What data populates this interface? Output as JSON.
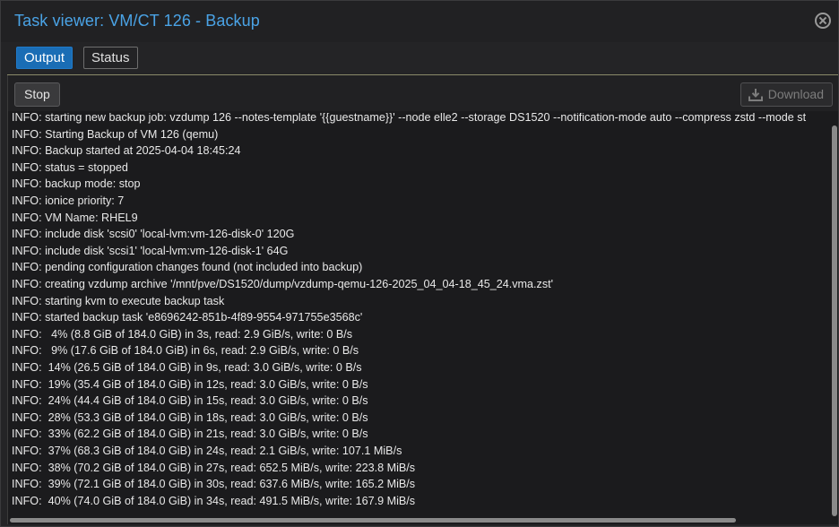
{
  "window": {
    "title": "Task viewer: VM/CT 126 - Backup"
  },
  "tabs": [
    {
      "label": "Output",
      "active": true
    },
    {
      "label": "Status",
      "active": false
    }
  ],
  "toolbar": {
    "stop_label": "Stop",
    "download_label": "Download"
  },
  "colors": {
    "accent": "#1a6db5",
    "title": "#4aa3e6"
  },
  "log": {
    "lines": [
      "INFO: starting new backup job: vzdump 126 --notes-template '{{guestname}}' --node elle2 --storage DS1520 --notification-mode auto --compress zstd --mode st",
      "INFO: Starting Backup of VM 126 (qemu)",
      "INFO: Backup started at 2025-04-04 18:45:24",
      "INFO: status = stopped",
      "INFO: backup mode: stop",
      "INFO: ionice priority: 7",
      "INFO: VM Name: RHEL9",
      "INFO: include disk 'scsi0' 'local-lvm:vm-126-disk-0' 120G",
      "INFO: include disk 'scsi1' 'local-lvm:vm-126-disk-1' 64G",
      "INFO: pending configuration changes found (not included into backup)",
      "INFO: creating vzdump archive '/mnt/pve/DS1520/dump/vzdump-qemu-126-2025_04_04-18_45_24.vma.zst'",
      "INFO: starting kvm to execute backup task",
      "INFO: started backup task 'e8696242-851b-4f89-9554-971755e3568c'",
      "INFO:   4% (8.8 GiB of 184.0 GiB) in 3s, read: 2.9 GiB/s, write: 0 B/s",
      "INFO:   9% (17.6 GiB of 184.0 GiB) in 6s, read: 2.9 GiB/s, write: 0 B/s",
      "INFO:  14% (26.5 GiB of 184.0 GiB) in 9s, read: 3.0 GiB/s, write: 0 B/s",
      "INFO:  19% (35.4 GiB of 184.0 GiB) in 12s, read: 3.0 GiB/s, write: 0 B/s",
      "INFO:  24% (44.4 GiB of 184.0 GiB) in 15s, read: 3.0 GiB/s, write: 0 B/s",
      "INFO:  28% (53.3 GiB of 184.0 GiB) in 18s, read: 3.0 GiB/s, write: 0 B/s",
      "INFO:  33% (62.2 GiB of 184.0 GiB) in 21s, read: 3.0 GiB/s, write: 0 B/s",
      "INFO:  37% (68.3 GiB of 184.0 GiB) in 24s, read: 2.1 GiB/s, write: 107.1 MiB/s",
      "INFO:  38% (70.2 GiB of 184.0 GiB) in 27s, read: 652.5 MiB/s, write: 223.8 MiB/s",
      "INFO:  39% (72.1 GiB of 184.0 GiB) in 30s, read: 637.6 MiB/s, write: 165.2 MiB/s",
      "INFO:  40% (74.0 GiB of 184.0 GiB) in 34s, read: 491.5 MiB/s, write: 167.9 MiB/s"
    ]
  }
}
